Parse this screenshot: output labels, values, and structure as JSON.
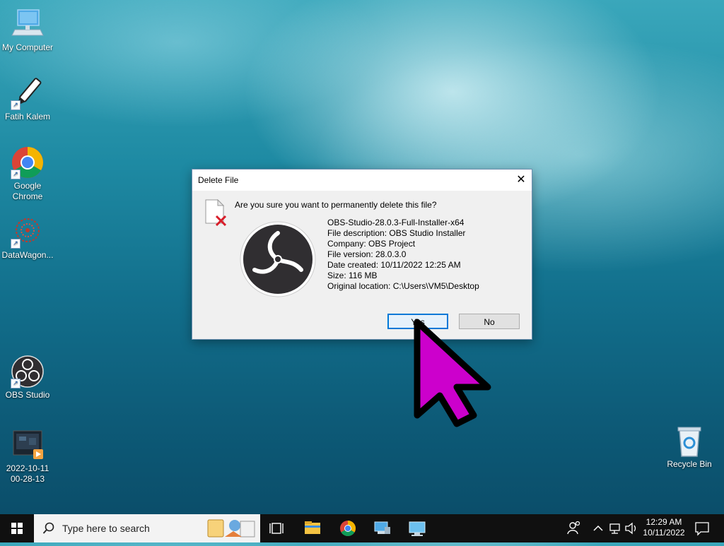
{
  "desktop": {
    "icons": [
      {
        "label": "My Computer"
      },
      {
        "label": "Fatih Kalem"
      },
      {
        "label": "Google Chrome"
      },
      {
        "label": "DataWagon..."
      },
      {
        "label": "OBS Studio"
      },
      {
        "label": "2022-10-11 00-28-13"
      },
      {
        "label": "Recycle Bin"
      }
    ]
  },
  "dialog": {
    "title": "Delete File",
    "close_glyph": "✕",
    "question": "Are you sure you want to permanently delete this file?",
    "file_name": "OBS-Studio-28.0.3-Full-Installer-x64",
    "description": "File description: OBS Studio Installer",
    "company": "Company: OBS Project",
    "version": "File version: 28.0.3.0",
    "date_created": "Date created: 10/11/2022 12:25 AM",
    "size": "Size: 116 MB",
    "location": "Original location: C:\\Users\\VM5\\Desktop",
    "yes_label": "Yes",
    "no_label": "No"
  },
  "taskbar": {
    "search_placeholder": "Type here to search",
    "time": "12:29 AM",
    "date": "10/11/2022"
  },
  "colors": {
    "cursor": "#cc00cc",
    "accent": "#0078d7",
    "delete_x": "#d81e2a"
  },
  "icons": [
    "start-icon",
    "search-icon",
    "task-view-icon",
    "file-explorer-icon",
    "chrome-icon",
    "network-icon",
    "people-icon",
    "chevron-up-icon",
    "speaker-icon",
    "notification-icon"
  ]
}
